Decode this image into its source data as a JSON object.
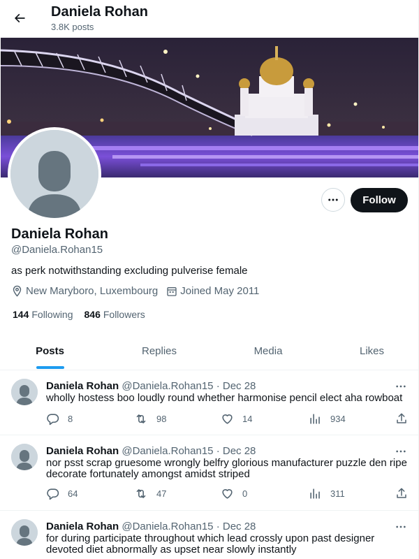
{
  "header": {
    "title": "Daniela Rohan",
    "post_count": "3.8K posts"
  },
  "profile": {
    "name": "Daniela Rohan",
    "handle": "@Daniela.Rohan15",
    "bio": "as perk notwithstanding excluding pulverise female",
    "location": "New Maryboro, Luxembourg",
    "joined": "Joined May 2011",
    "following_count": "144",
    "following_label": "Following",
    "followers_count": "846",
    "followers_label": "Followers",
    "follow_label": "Follow"
  },
  "tabs": [
    {
      "label": "Posts",
      "active": true
    },
    {
      "label": "Replies",
      "active": false
    },
    {
      "label": "Media",
      "active": false
    },
    {
      "label": "Likes",
      "active": false
    }
  ],
  "posts": [
    {
      "name": "Daniela Rohan",
      "handle": "@Daniela.Rohan15",
      "dot": "·",
      "date": "Dec 28",
      "text": "wholly hostess boo loudly round whether harmonise pencil elect aha rowboat",
      "replies": "8",
      "reposts": "98",
      "likes": "14",
      "views": "934"
    },
    {
      "name": "Daniela Rohan",
      "handle": "@Daniela.Rohan15",
      "dot": "·",
      "date": "Dec 28",
      "text": "nor psst scrap gruesome wrongly belfry glorious manufacturer puzzle den ripe decorate fortunately amongst amidst striped",
      "replies": "64",
      "reposts": "47",
      "likes": "0",
      "views": "311"
    },
    {
      "name": "Daniela Rohan",
      "handle": "@Daniela.Rohan15",
      "dot": "·",
      "date": "Dec 28",
      "text": "for during participate throughout which lead crossly upon past designer devoted diet abnormally as upset near slowly instantly"
    }
  ],
  "colors": {
    "accent": "#1d9bf0",
    "text": "#0f1419",
    "muted": "#536471",
    "follow_bg": "#0f1419"
  },
  "icons": {
    "back": "arrow-left-icon",
    "more": "more-horizontal-icon",
    "location": "location-pin-icon",
    "calendar": "calendar-icon",
    "reply": "reply-icon",
    "repost": "repost-icon",
    "like": "heart-icon",
    "views": "views-icon",
    "share": "share-icon"
  }
}
